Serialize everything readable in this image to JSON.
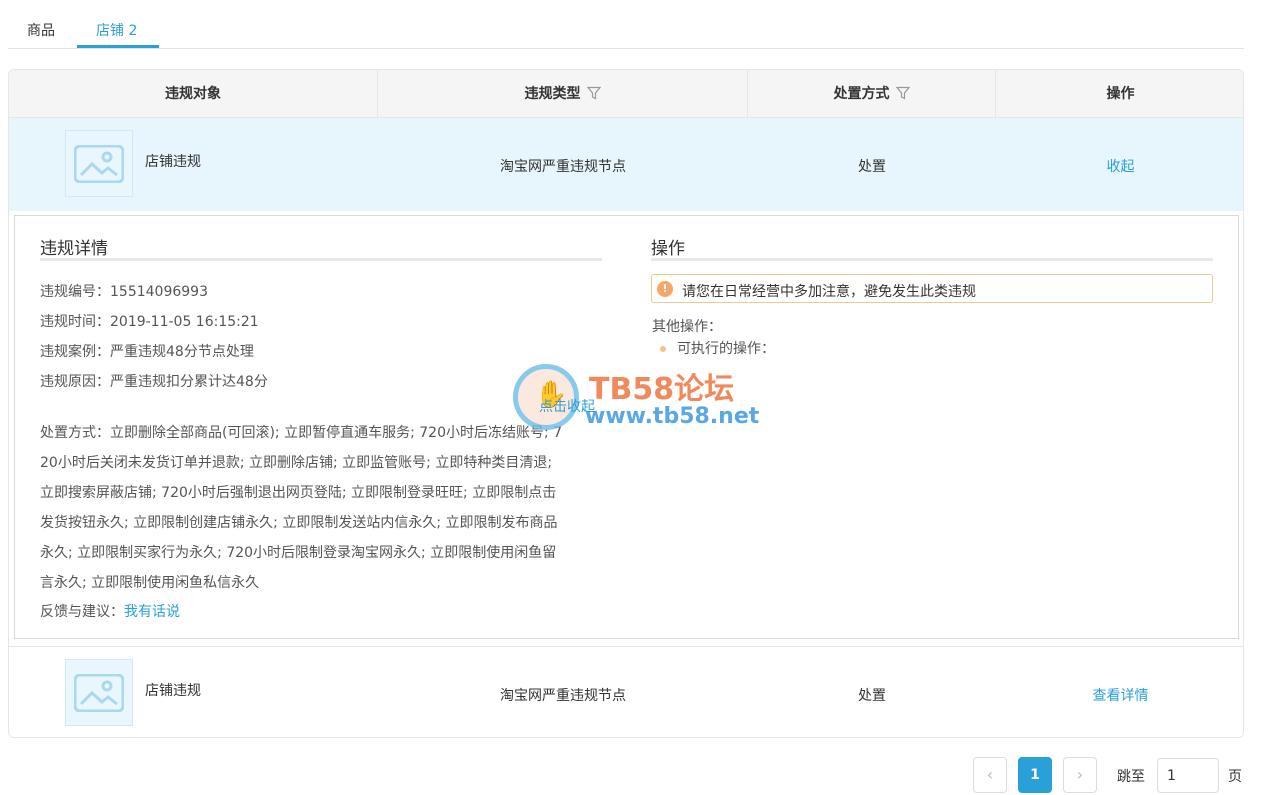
{
  "tabs": [
    {
      "label": "商品"
    },
    {
      "label": "店铺 2"
    }
  ],
  "table": {
    "headers": {
      "object": "违规对象",
      "type": "违规类型",
      "handling": "处置方式",
      "action": "操作"
    },
    "rows": [
      {
        "object": "店铺违规",
        "type": "淘宝网严重违规节点",
        "handling": "处置",
        "action": "收起"
      },
      {
        "object": "店铺违规",
        "type": "淘宝网严重违规节点",
        "handling": "处置",
        "action": "查看详情"
      }
    ]
  },
  "detail": {
    "title": "违规详情",
    "number": "违规编号：15514096993",
    "time": "违规时间：2019-11-05 16:15:21",
    "case": "违规案例：严重违规48分节点处理",
    "reason": "违规原因：严重违规扣分累计达48分",
    "handling_lines": [
      "处置方式：立即删除全部商品(可回滚); 立即暂停直通车服务; 720小时后冻结账号; 7",
      "20小时后关闭未发货订单并退款; 立即删除店铺; 立即监管账号; 立即特种类目清退;",
      "立即搜索屏蔽店铺; 720小时后强制退出网页登陆; 立即限制登录旺旺; 立即限制点击",
      "发货按钮永久; 立即限制创建店铺永久; 立即限制发送站内信永久; 立即限制发布商品",
      "永久; 立即限制买家行为永久; 720小时后限制登录淘宝网永久; 立即限制使用闲鱼留",
      "言永久; 立即限制使用闲鱼私信永久"
    ],
    "feedback_label": "反馈与建议：",
    "feedback_link": "我有话说"
  },
  "operations": {
    "title": "操作",
    "notice": "请您在日常经营中多加注意，避免发生此类违规",
    "other_label": "其他操作：",
    "bullet": "可执行的操作："
  },
  "watermark": {
    "title": "TB58论坛",
    "url": "www.tb58.net",
    "overlay": "点击收起"
  },
  "pagination": {
    "current": "1",
    "jump_label": "跳至",
    "jump_value": "1",
    "unit": "页"
  },
  "colors": {
    "accent": "#2aa0d8",
    "warning": "#f5a76a"
  }
}
